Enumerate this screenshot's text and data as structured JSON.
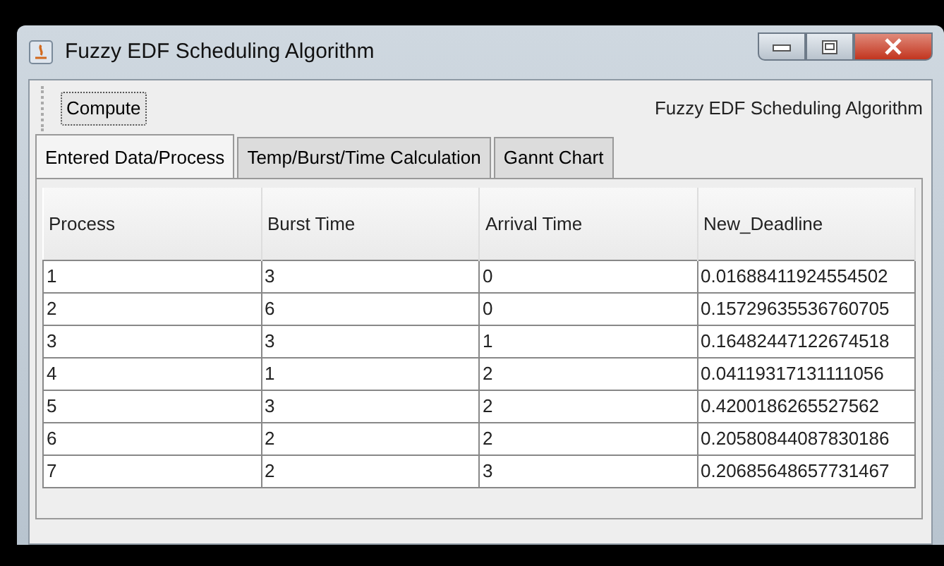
{
  "window": {
    "title": "Fuzzy EDF Scheduling Algorithm"
  },
  "toolbar": {
    "button": "Compute",
    "label": "Fuzzy EDF Scheduling Algorithm"
  },
  "tabs": [
    {
      "label": "Entered Data/Process",
      "selected": true
    },
    {
      "label": "Temp/Burst/Time Calculation",
      "selected": false
    },
    {
      "label": "Gannt Chart",
      "selected": false
    }
  ],
  "table": {
    "columns": [
      "Process",
      "Burst Time",
      "Arrival Time",
      "New_Deadline"
    ],
    "rows": [
      [
        "1",
        "3",
        "0",
        "0.01688411924554502"
      ],
      [
        "2",
        "6",
        "0",
        "0.15729635536760705"
      ],
      [
        "3",
        "3",
        "1",
        "0.16482447122674518"
      ],
      [
        "4",
        "1",
        "2",
        "0.04119317131111056"
      ],
      [
        "5",
        "3",
        "2",
        "0.4200186265527562"
      ],
      [
        "6",
        "2",
        "2",
        "0.20580844087830186"
      ],
      [
        "7",
        "2",
        "3",
        "0.20685648657731467"
      ]
    ]
  }
}
